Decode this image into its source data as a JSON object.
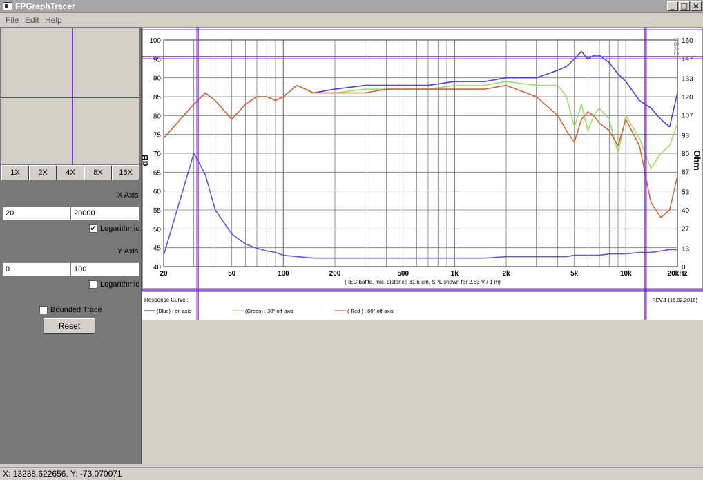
{
  "window": {
    "title": "FPGraphTracer"
  },
  "menu": [
    "File",
    "Edit",
    "Help"
  ],
  "zoom_buttons": [
    "1X",
    "2X",
    "4X",
    "8X",
    "16X"
  ],
  "x_axis": {
    "label": "X Axis",
    "min": "20",
    "max": "20000",
    "logarithmic_label": "Logarithmic",
    "logarithmic_checked": true
  },
  "y_axis": {
    "label": "Y Axis",
    "min": "0",
    "max": "100",
    "logarithmic_label": "Logarithmic",
    "logarithmic_checked": false
  },
  "bounded_trace": {
    "label": "Bounded Trace",
    "checked": false
  },
  "reset_label": "Reset",
  "status": "X: 13238.622656, Y: -73.070071",
  "graph": {
    "left_axis_title": "dB",
    "right_axis_title": "Ohm",
    "watermark": "SBAC",
    "caption": "( IEC baffle, mic. distance 31.6 cm, SPL shown for 2.83 V / 1 m)",
    "legend_title": "Response Curve :",
    "revision": "REV.1 (16.02.2016)",
    "legend": [
      {
        "label": "(Blue) : on axis",
        "color": "#4b3fe0"
      },
      {
        "label": "(Green) : 30° off-axis",
        "color": "#9be06a"
      },
      {
        "label": "( Red ) : 60° off-axis",
        "color": "#d6663a"
      }
    ],
    "db_ticks": [
      "100",
      "95",
      "90",
      "85",
      "80",
      "75",
      "70",
      "65",
      "60",
      "55",
      "50",
      "45",
      "40"
    ],
    "ohm_ticks": [
      "160",
      "147",
      "133",
      "120",
      "107",
      "93",
      "80",
      "67",
      "53",
      "40",
      "27",
      "13",
      "0"
    ],
    "freq_ticks": [
      "20",
      "50",
      "100",
      "200",
      "500",
      "1k",
      "2k",
      "5k",
      "10k",
      "20kHz"
    ],
    "colors": {
      "grid": "#7a7a7a",
      "frame": "#333333",
      "cursor": "#7a2ce0"
    }
  },
  "chart_data": {
    "type": "line",
    "title": "",
    "xlabel": "( IEC baffle, mic. distance 31.6 cm, SPL shown for 2.83 V / 1 m)",
    "ylabel": "dB",
    "y2label": "Ohm",
    "x_scale": "log",
    "xlim": [
      20,
      20000
    ],
    "ylim": [
      40,
      100
    ],
    "y2lim": [
      0,
      160
    ],
    "x": [
      20,
      30,
      35,
      40,
      50,
      60,
      70,
      80,
      90,
      100,
      120,
      150,
      200,
      300,
      400,
      500,
      700,
      1000,
      1500,
      2000,
      3000,
      4000,
      4500,
      5000,
      5500,
      6000,
      6500,
      7000,
      8000,
      9000,
      10000,
      12000,
      14000,
      16000,
      18000,
      20000
    ],
    "series": [
      {
        "name": "(Blue) : on axis",
        "axis": "left",
        "color": "#4b3fe0",
        "values": [
          74,
          83,
          86,
          84,
          79,
          83,
          85,
          85,
          84,
          85,
          88,
          86,
          87,
          88,
          88,
          88,
          88,
          89,
          89,
          90,
          90,
          92,
          93,
          95,
          97,
          95,
          96,
          96,
          94,
          91,
          89,
          84,
          82,
          79,
          77,
          86
        ]
      },
      {
        "name": "(Green) : 30° off-axis",
        "axis": "left",
        "color": "#9be06a",
        "values": [
          74,
          83,
          86,
          84,
          79,
          83,
          85,
          85,
          84,
          85,
          88,
          86,
          86,
          87,
          87,
          87,
          87,
          88,
          88,
          89,
          88,
          88,
          85,
          77,
          83,
          76,
          80,
          82,
          79,
          70,
          80,
          74,
          66,
          70,
          72,
          78
        ]
      },
      {
        "name": "( Red ) : 60° off-axis",
        "axis": "left",
        "color": "#d6663a",
        "values": [
          74,
          83,
          86,
          84,
          79,
          83,
          85,
          85,
          84,
          85,
          88,
          86,
          86,
          86,
          87,
          87,
          87,
          87,
          87,
          88,
          85,
          80,
          76,
          73,
          79,
          81,
          80,
          78,
          76,
          72,
          79,
          72,
          57,
          53,
          55,
          64
        ]
      },
      {
        "name": "Impedance",
        "axis": "right",
        "color": "#6f4fd8",
        "values": [
          8,
          80,
          65,
          40,
          23,
          16,
          13,
          11,
          10,
          8,
          7,
          6,
          6,
          6,
          6,
          6,
          6,
          6,
          6,
          7,
          7,
          7,
          7,
          8,
          8,
          8,
          8,
          8,
          9,
          9,
          9,
          10,
          10,
          11,
          12,
          12
        ]
      }
    ]
  }
}
